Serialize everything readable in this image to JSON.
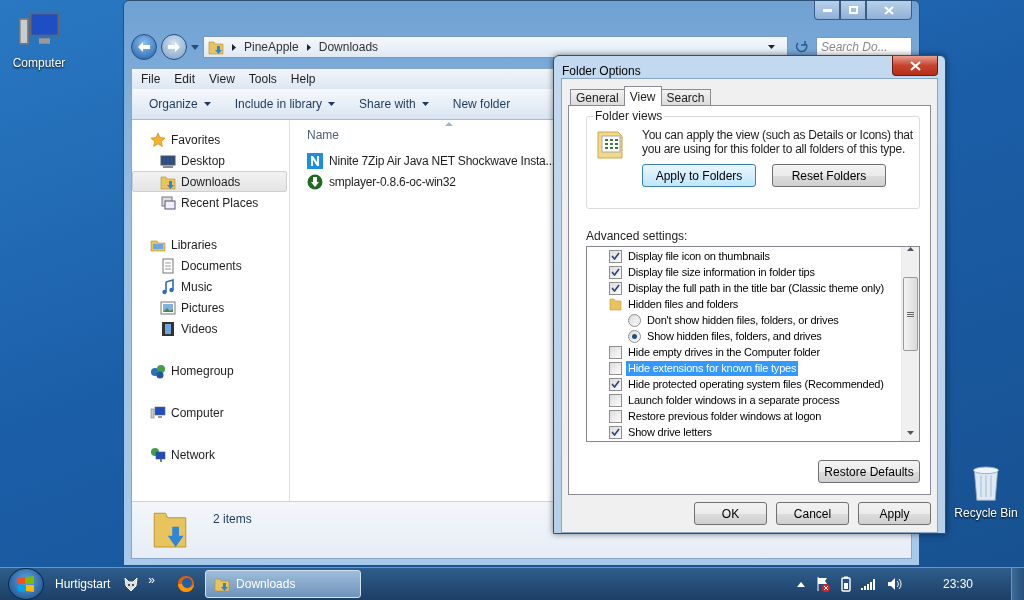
{
  "desktop_icons": [
    {
      "label": "Computer",
      "kind": "computer"
    },
    {
      "label": "Recycle Bin",
      "kind": "bin"
    }
  ],
  "explorer": {
    "breadcrumb": [
      "PineApple",
      "Downloads"
    ],
    "search": {
      "placeholder": "Search Do..."
    },
    "menu": [
      "File",
      "Edit",
      "View",
      "Tools",
      "Help"
    ],
    "commands": [
      {
        "label": "Organize",
        "dropdown": true
      },
      {
        "label": "Include in library",
        "dropdown": true
      },
      {
        "label": "Share with",
        "dropdown": true
      },
      {
        "label": "New folder",
        "dropdown": false
      }
    ],
    "nav": [
      {
        "label": "Favorites",
        "kind": "star",
        "selected": false,
        "children": [
          {
            "label": "Desktop",
            "kind": "desktop",
            "selected": false
          },
          {
            "label": "Downloads",
            "kind": "downloads",
            "selected": true
          },
          {
            "label": "Recent Places",
            "kind": "recent",
            "selected": false
          }
        ]
      },
      {
        "label": "Libraries",
        "kind": "library",
        "selected": false,
        "children": [
          {
            "label": "Documents",
            "kind": "documents",
            "selected": false
          },
          {
            "label": "Music",
            "kind": "music",
            "selected": false
          },
          {
            "label": "Pictures",
            "kind": "pictures",
            "selected": false
          },
          {
            "label": "Videos",
            "kind": "videos",
            "selected": false
          }
        ]
      },
      {
        "label": "Homegroup",
        "kind": "homegroup",
        "selected": false
      },
      {
        "label": "Computer",
        "kind": "computer",
        "selected": false
      },
      {
        "label": "Network",
        "kind": "network",
        "selected": false
      }
    ],
    "columns": [
      "Name"
    ],
    "files": [
      {
        "name": "Ninite 7Zip Air Java NET Shockwave Insta...",
        "kind": "ninite"
      },
      {
        "name": "smplayer-0.8.6-oc-win32",
        "kind": "installer"
      }
    ],
    "status": "2 items"
  },
  "dialog": {
    "title": "Folder Options",
    "tabs": [
      {
        "label": "General",
        "selected": false
      },
      {
        "label": "View",
        "selected": true
      },
      {
        "label": "Search",
        "selected": false
      }
    ],
    "folder_views": {
      "label": "Folder views",
      "text": "You can apply the view (such as Details or Icons) that you are using for this folder to all folders of this type.",
      "buttons": [
        "Apply to Folders",
        "Reset Folders"
      ]
    },
    "advanced_label": "Advanced settings:",
    "settings": [
      {
        "kind": "checkbox",
        "label": "Display file icon on thumbnails",
        "checked": true,
        "selected": false
      },
      {
        "kind": "checkbox",
        "label": "Display file size information in folder tips",
        "checked": true,
        "selected": false
      },
      {
        "kind": "checkbox",
        "label": "Display the full path in the title bar (Classic theme only)",
        "checked": true,
        "selected": false
      },
      {
        "kind": "folder",
        "label": "Hidden files and folders",
        "selected": false,
        "children": [
          {
            "kind": "radio",
            "label": "Don't show hidden files, folders, or drives",
            "checked": false,
            "selected": false
          },
          {
            "kind": "radio",
            "label": "Show hidden files, folders, and drives",
            "checked": true,
            "selected": false
          }
        ]
      },
      {
        "kind": "checkbox",
        "label": "Hide empty drives in the Computer folder",
        "checked": false,
        "selected": false
      },
      {
        "kind": "checkbox",
        "label": "Hide extensions for known file types",
        "checked": false,
        "selected": true
      },
      {
        "kind": "checkbox",
        "label": "Hide protected operating system files (Recommended)",
        "checked": true,
        "selected": false
      },
      {
        "kind": "checkbox",
        "label": "Launch folder windows in a separate process",
        "checked": false,
        "selected": false
      },
      {
        "kind": "checkbox",
        "label": "Restore previous folder windows at logon",
        "checked": false,
        "selected": false
      },
      {
        "kind": "checkbox",
        "label": "Show drive letters",
        "checked": true,
        "selected": false
      }
    ],
    "restore_button": "Restore Defaults",
    "buttons": [
      "OK",
      "Cancel",
      "Apply"
    ]
  },
  "taskbar": {
    "quick_launch": "Hurtigstart",
    "overflow": "»",
    "tasks": [
      {
        "label": "Downloads",
        "selected": true
      }
    ],
    "clock": "23:30"
  }
}
